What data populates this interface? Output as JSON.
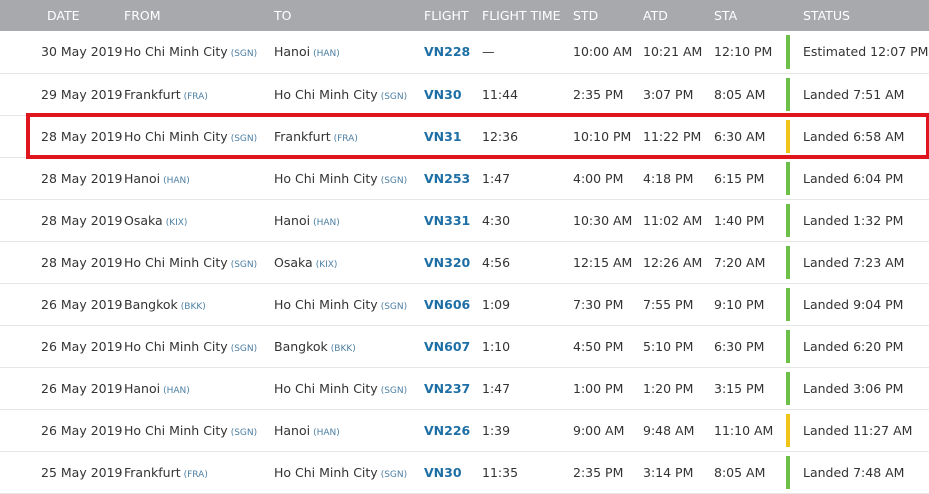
{
  "columns": {
    "date": "DATE",
    "from": "FROM",
    "to": "TO",
    "flight": "FLIGHT",
    "flight_time": "FLIGHT TIME",
    "std": "STD",
    "atd": "ATD",
    "sta": "STA",
    "status": "STATUS"
  },
  "status_colors": {
    "on_time": "#6cc04a",
    "delayed": "#f0c419"
  },
  "highlight_color": "#e0141c",
  "flights": [
    {
      "date": "30 May 2019",
      "from": "Ho Chi Minh City",
      "from_code": "(SGN)",
      "to": "Hanoi",
      "to_code": "(HAN)",
      "flight": "VN228",
      "flight_time": "—",
      "std": "10:00 AM",
      "atd": "10:21 AM",
      "sta": "12:10 PM",
      "status_color": "#6cc04a",
      "status": "Estimated 12:07 PM"
    },
    {
      "date": "29 May 2019",
      "from": "Frankfurt",
      "from_code": "(FRA)",
      "to": "Ho Chi Minh City",
      "to_code": "(SGN)",
      "flight": "VN30",
      "flight_time": "11:44",
      "std": "2:35 PM",
      "atd": "3:07 PM",
      "sta": "8:05 AM",
      "status_color": "#6cc04a",
      "status": "Landed 7:51 AM"
    },
    {
      "date": "28 May 2019",
      "from": "Ho Chi Minh City",
      "from_code": "(SGN)",
      "to": "Frankfurt",
      "to_code": "(FRA)",
      "flight": "VN31",
      "flight_time": "12:36",
      "std": "10:10 PM",
      "atd": "11:22 PM",
      "sta": "6:30 AM",
      "status_color": "#f0c419",
      "status": "Landed 6:58 AM"
    },
    {
      "date": "28 May 2019",
      "from": "Hanoi",
      "from_code": "(HAN)",
      "to": "Ho Chi Minh City",
      "to_code": "(SGN)",
      "flight": "VN253",
      "flight_time": "1:47",
      "std": "4:00 PM",
      "atd": "4:18 PM",
      "sta": "6:15 PM",
      "status_color": "#6cc04a",
      "status": "Landed 6:04 PM"
    },
    {
      "date": "28 May 2019",
      "from": "Osaka",
      "from_code": "(KIX)",
      "to": "Hanoi",
      "to_code": "(HAN)",
      "flight": "VN331",
      "flight_time": "4:30",
      "std": "10:30 AM",
      "atd": "11:02 AM",
      "sta": "1:40 PM",
      "status_color": "#6cc04a",
      "status": "Landed 1:32 PM"
    },
    {
      "date": "28 May 2019",
      "from": "Ho Chi Minh City",
      "from_code": "(SGN)",
      "to": "Osaka",
      "to_code": "(KIX)",
      "flight": "VN320",
      "flight_time": "4:56",
      "std": "12:15 AM",
      "atd": "12:26 AM",
      "sta": "7:20 AM",
      "status_color": "#6cc04a",
      "status": "Landed 7:23 AM"
    },
    {
      "date": "26 May 2019",
      "from": "Bangkok",
      "from_code": "(BKK)",
      "to": "Ho Chi Minh City",
      "to_code": "(SGN)",
      "flight": "VN606",
      "flight_time": "1:09",
      "std": "7:30 PM",
      "atd": "7:55 PM",
      "sta": "9:10 PM",
      "status_color": "#6cc04a",
      "status": "Landed 9:04 PM"
    },
    {
      "date": "26 May 2019",
      "from": "Ho Chi Minh City",
      "from_code": "(SGN)",
      "to": "Bangkok",
      "to_code": "(BKK)",
      "flight": "VN607",
      "flight_time": "1:10",
      "std": "4:50 PM",
      "atd": "5:10 PM",
      "sta": "6:30 PM",
      "status_color": "#6cc04a",
      "status": "Landed 6:20 PM"
    },
    {
      "date": "26 May 2019",
      "from": "Hanoi",
      "from_code": "(HAN)",
      "to": "Ho Chi Minh City",
      "to_code": "(SGN)",
      "flight": "VN237",
      "flight_time": "1:47",
      "std": "1:00 PM",
      "atd": "1:20 PM",
      "sta": "3:15 PM",
      "status_color": "#6cc04a",
      "status": "Landed 3:06 PM"
    },
    {
      "date": "26 May 2019",
      "from": "Ho Chi Minh City",
      "from_code": "(SGN)",
      "to": "Hanoi",
      "to_code": "(HAN)",
      "flight": "VN226",
      "flight_time": "1:39",
      "std": "9:00 AM",
      "atd": "9:48 AM",
      "sta": "11:10 AM",
      "status_color": "#f0c419",
      "status": "Landed 11:27 AM"
    },
    {
      "date": "25 May 2019",
      "from": "Frankfurt",
      "from_code": "(FRA)",
      "to": "Ho Chi Minh City",
      "to_code": "(SGN)",
      "flight": "VN30",
      "flight_time": "11:35",
      "std": "2:35 PM",
      "atd": "3:14 PM",
      "sta": "8:05 AM",
      "status_color": "#6cc04a",
      "status": "Landed 7:48 AM"
    }
  ]
}
